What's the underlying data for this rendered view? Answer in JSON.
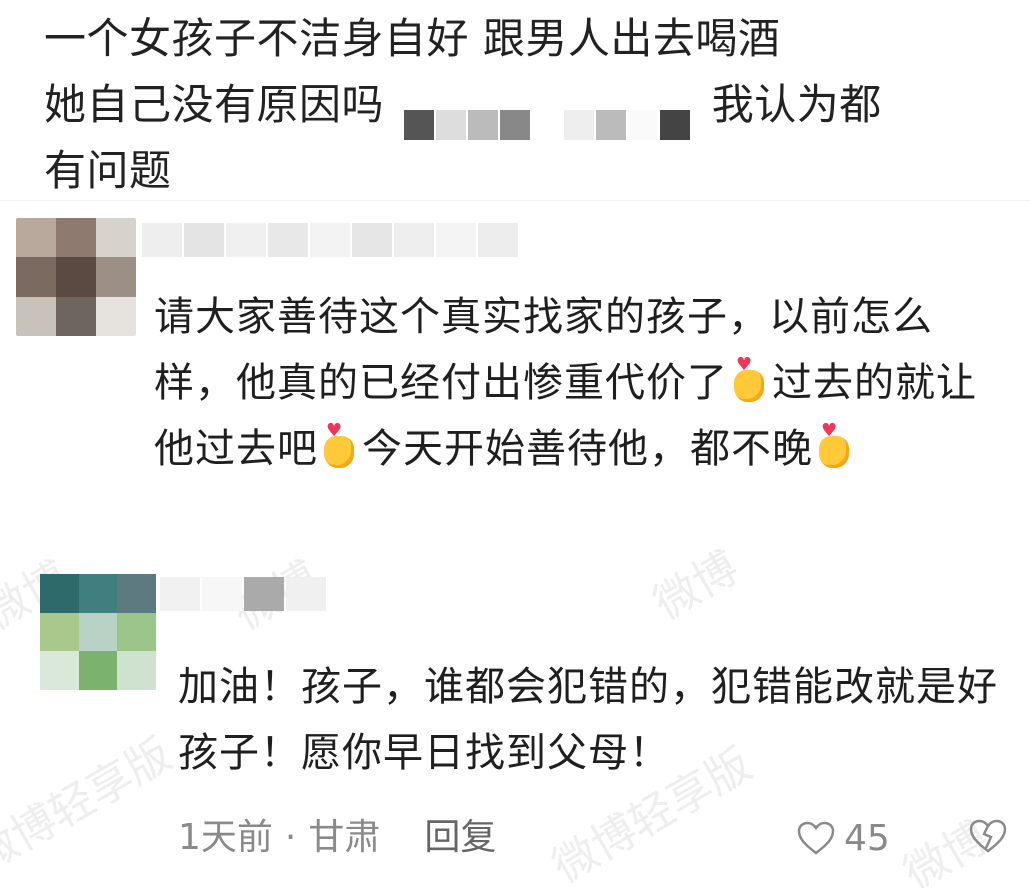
{
  "parent_comment": {
    "line1": "一个女孩子不洁身自好  跟男人出去喝酒",
    "line2_start": "她自己没有原因吗",
    "line2_end": "我认为都",
    "line3": "有问题"
  },
  "reply1": {
    "text_a": "请大家善待这个真实找家的孩子，以前怎么样，他真的已经付出惨重代价了",
    "text_b": "过去的就让他过去吧",
    "text_c": "今天开始善待他，都不晚",
    "emoji": "finger-heart-icon"
  },
  "reply2": {
    "text": "加油！孩子，谁都会犯错的，犯错能改就是好孩子！愿你早日找到父母！",
    "time": "1天前",
    "separator": "·",
    "location": "甘肃",
    "reply_label": "回复",
    "likes": "45"
  },
  "watermark": {
    "text1": "微博",
    "text2": "微博轻享版"
  },
  "colors": {
    "text": "#1f1f1f",
    "meta": "#8a8a8a",
    "heart": "#f0355a",
    "emoji_hand": "#ffc93a"
  }
}
